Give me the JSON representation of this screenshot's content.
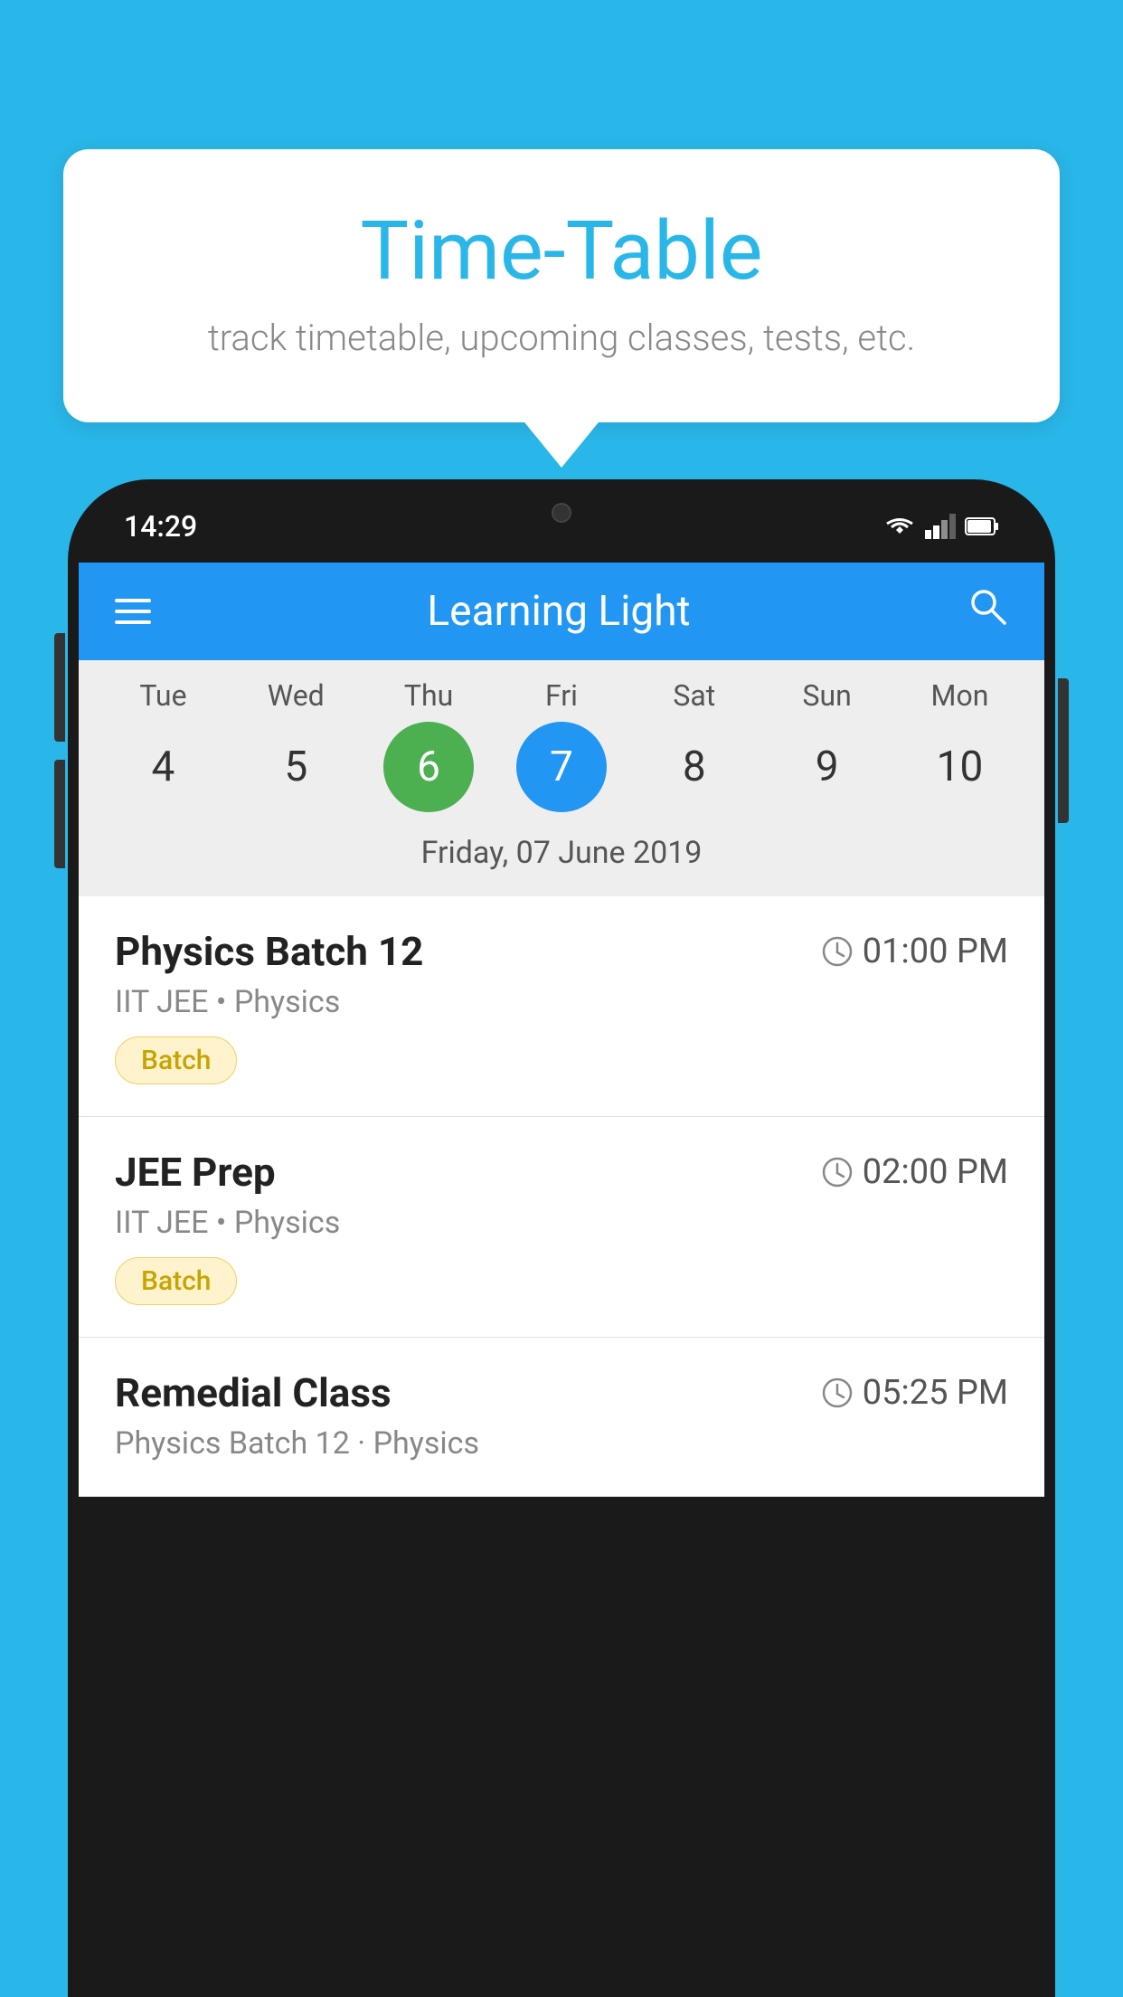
{
  "background_color": "#29b6e8",
  "tooltip": {
    "title": "Time-Table",
    "subtitle": "track timetable, upcoming classes, tests, etc."
  },
  "phone": {
    "status_bar": {
      "time": "14:29"
    },
    "app_header": {
      "title": "Learning Light"
    },
    "calendar": {
      "days": [
        "Tue",
        "Wed",
        "Thu",
        "Fri",
        "Sat",
        "Sun",
        "Mon"
      ],
      "dates": [
        "4",
        "5",
        "6",
        "7",
        "8",
        "9",
        "10"
      ],
      "today_index": 2,
      "selected_index": 3,
      "selected_date_label": "Friday, 07 June 2019"
    },
    "classes": [
      {
        "name": "Physics Batch 12",
        "time": "01:00 PM",
        "meta": "IIT JEE • Physics",
        "badge": "Batch"
      },
      {
        "name": "JEE Prep",
        "time": "02:00 PM",
        "meta": "IIT JEE • Physics",
        "badge": "Batch"
      },
      {
        "name": "Remedial Class",
        "time": "05:25 PM",
        "meta": "Physics Batch 12 · Physics",
        "badge": null
      }
    ]
  }
}
